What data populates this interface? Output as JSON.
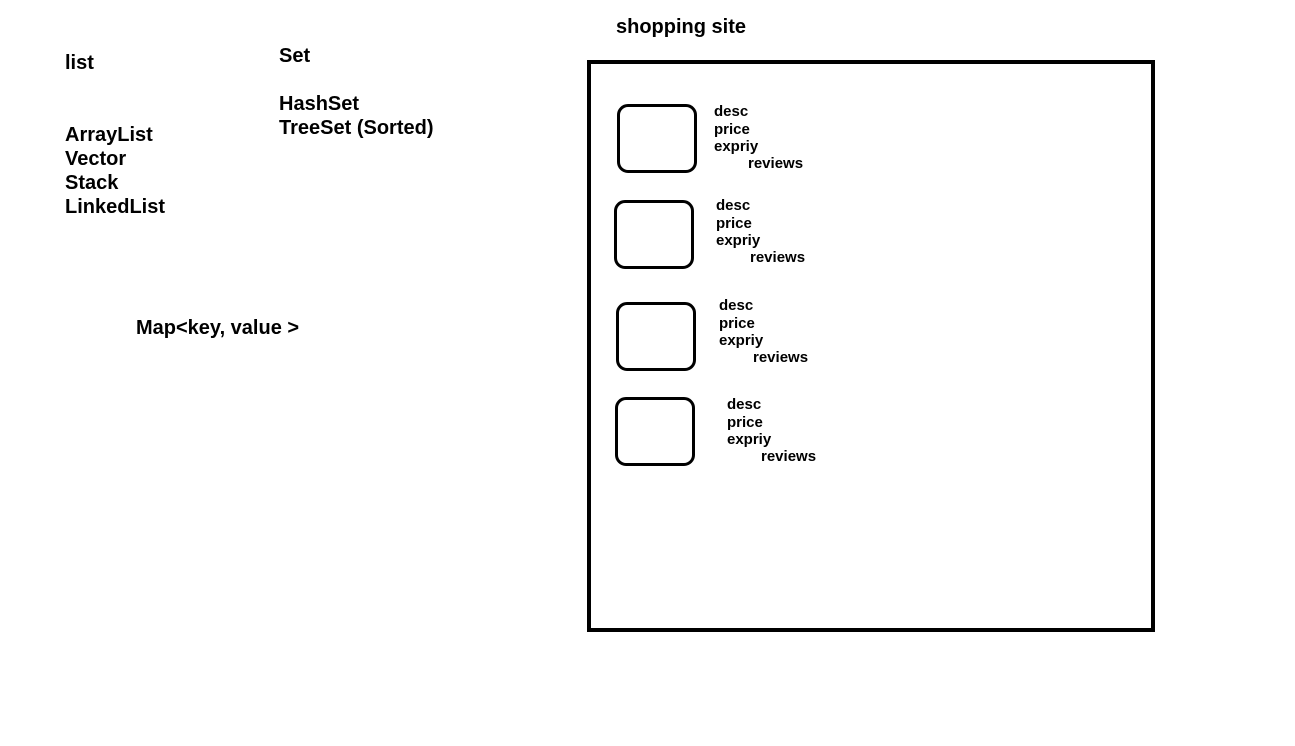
{
  "collections": {
    "list_heading": "list",
    "list_items": [
      "ArrayList",
      "Vector",
      "Stack",
      "LinkedList"
    ],
    "set_heading": "Set",
    "set_items": [
      "HashSet",
      "TreeSet (Sorted)"
    ],
    "map_label": "Map<key, value >"
  },
  "shopping": {
    "title": "shopping site",
    "products": [
      {
        "desc": "desc",
        "price": "price",
        "expiry": "expriy",
        "reviews": "reviews"
      },
      {
        "desc": "desc",
        "price": "price",
        "expiry": "expriy",
        "reviews": "reviews"
      },
      {
        "desc": "desc",
        "price": "price",
        "expiry": "expriy",
        "reviews": "reviews"
      },
      {
        "desc": "desc",
        "price": "price",
        "expiry": "expriy",
        "reviews": "reviews"
      }
    ]
  }
}
